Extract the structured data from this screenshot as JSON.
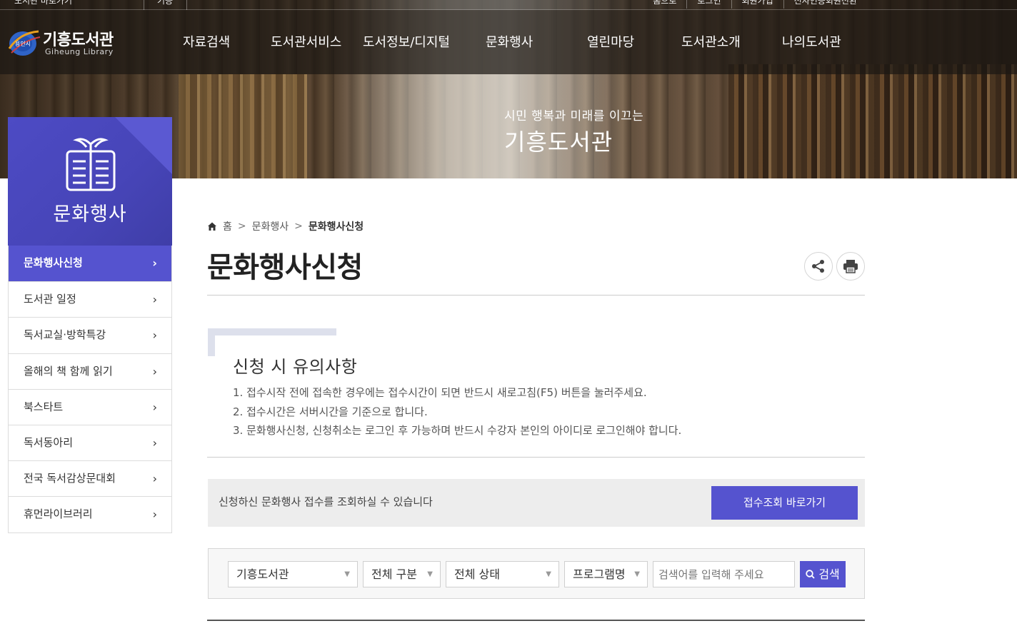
{
  "utility": {
    "left1": "도서관 바로가기",
    "left2": "기능",
    "links": [
      "홈으로",
      "로그인",
      "회원가입",
      "전자인증회원전환"
    ]
  },
  "logo": {
    "title": "기흥도서관",
    "subtitle": "Giheung Library",
    "emblem_text": "용인시"
  },
  "nav": [
    "자료검색",
    "도서관서비스",
    "도서정보/디지털",
    "문화행사",
    "열린마당",
    "도서관소개",
    "나의도서관"
  ],
  "hero": {
    "subtitle": "시민 행복과 미래를 이끄는",
    "title": "기흥도서관"
  },
  "sidebar": {
    "title": "문화행사",
    "items": [
      {
        "label": "문화행사신청",
        "active": true
      },
      {
        "label": "도서관 일정"
      },
      {
        "label": "독서교실·방학특강"
      },
      {
        "label": "올해의 책 함께 읽기"
      },
      {
        "label": "북스타트"
      },
      {
        "label": "독서동아리"
      },
      {
        "label": "전국 독서감상문대회"
      },
      {
        "label": "휴먼라이브러리"
      }
    ]
  },
  "breadcrumb": {
    "home": "홈",
    "level1": "문화행사",
    "current": "문화행사신청",
    "sep": ">"
  },
  "page": {
    "title": "문화행사신청"
  },
  "notice": {
    "title": "신청 시 유의사항",
    "items": [
      "1. 접수시작 전에 접속한 경우에는 접수시간이 되면 반드시 새로고침(F5) 버튼을 눌러주세요.",
      "2. 접수시간은 서버시간을 기준으로 합니다.",
      "3. 문화행사신청, 신청취소는 로그인 후 가능하며 반드시 수강자 본인의 아이디로 로그인해야 합니다."
    ]
  },
  "lookup": {
    "text": "신청하신 문화행사 접수를 조회하실 수 있습니다",
    "button": "접수조회 바로가기"
  },
  "search": {
    "library": "기흥도서관",
    "category": "전체 구분",
    "status": "전체 상태",
    "field": "프로그램명",
    "placeholder": "검색어를 입력해 주세요",
    "button": "검색"
  },
  "colors": {
    "accent": "#5553cf",
    "sidebar_head": "#4745b8"
  }
}
